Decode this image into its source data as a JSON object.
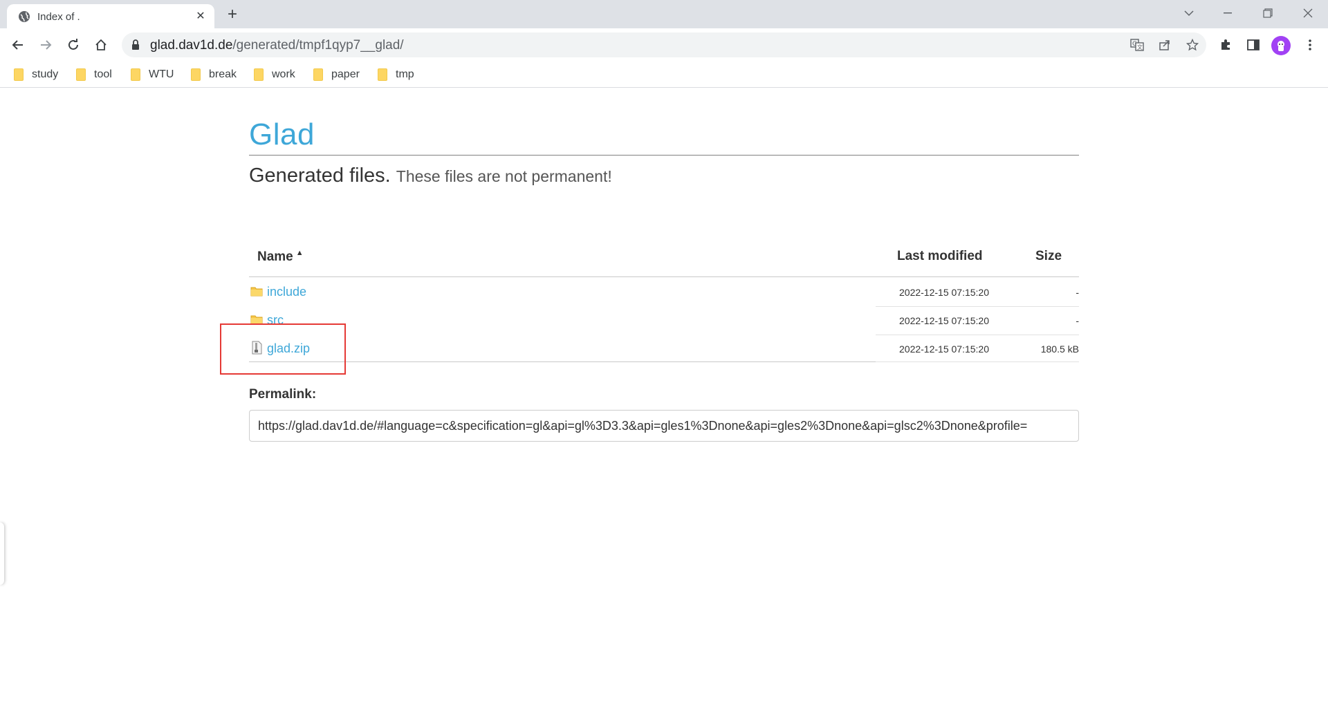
{
  "browser": {
    "tab": {
      "title": "Index of .",
      "favicon": "globe-icon"
    },
    "url": {
      "host": "glad.dav1d.de",
      "path": "/generated/tmpf1qyp7__glad/"
    },
    "bookmarks": [
      {
        "label": "study"
      },
      {
        "label": "tool"
      },
      {
        "label": "WTU"
      },
      {
        "label": "break"
      },
      {
        "label": "work"
      },
      {
        "label": "paper"
      },
      {
        "label": "tmp"
      }
    ]
  },
  "page": {
    "title": "Glad",
    "subtitle": "Generated files.",
    "subtitle_small": "These files are not permanent!",
    "table": {
      "headers": {
        "name": "Name",
        "modified": "Last modified",
        "size": "Size"
      },
      "rows": [
        {
          "name": "include",
          "modified": "2022-12-15 07:15:20",
          "size": "-",
          "icon": "folder-icon"
        },
        {
          "name": "src",
          "modified": "2022-12-15 07:15:20",
          "size": "-",
          "icon": "folder-icon"
        },
        {
          "name": "glad.zip",
          "modified": "2022-12-15 07:15:20",
          "size": "180.5 kB",
          "icon": "zip-file-icon"
        }
      ]
    },
    "permalink": {
      "label": "Permalink:",
      "value": "https://glad.dav1d.de/#language=c&specification=gl&api=gl%3D3.3&api=gles1%3Dnone&api=gles2%3Dnone&api=glsc2%3Dnone&profile="
    }
  },
  "colors": {
    "accent": "#3ea7d8",
    "highlight": "#e53935",
    "folder": "#fdd663"
  }
}
